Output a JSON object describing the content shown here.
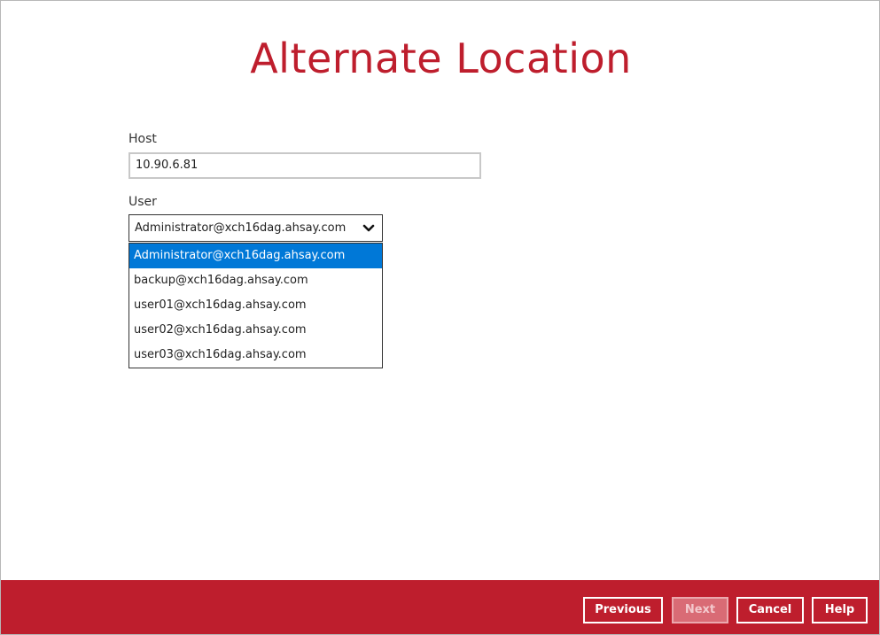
{
  "page": {
    "title": "Alternate Location"
  },
  "form": {
    "host_label": "Host",
    "host_value": "10.90.6.81",
    "user_label": "User",
    "user_selected": "Administrator@xch16dag.ahsay.com",
    "user_options": [
      "Administrator@xch16dag.ahsay.com",
      "backup@xch16dag.ahsay.com",
      "user01@xch16dag.ahsay.com",
      "user02@xch16dag.ahsay.com",
      "user03@xch16dag.ahsay.com"
    ],
    "highlighted_option_index": 0
  },
  "footer": {
    "previous_label": "Previous",
    "next_label": "Next",
    "cancel_label": "Cancel",
    "help_label": "Help",
    "next_enabled": false
  },
  "icons": {
    "dropdown": "chevron-down-icon"
  },
  "colors": {
    "brand": "#be1e2d",
    "selection": "#0078d7"
  }
}
